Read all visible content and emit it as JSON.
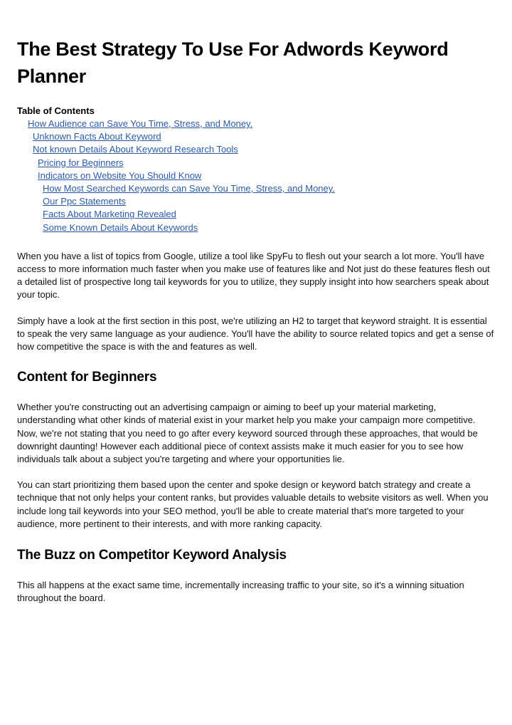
{
  "title": "The Best Strategy To Use For Adwords Keyword Planner",
  "toc": {
    "heading": "Table of Contents",
    "items": [
      {
        "label": "How Audience can Save You Time, Stress, and Money."
      },
      {
        "label": "Unknown Facts About Keyword"
      },
      {
        "label": "Not known Details About Keyword Research Tools"
      },
      {
        "label": "Pricing for Beginners"
      },
      {
        "label": "Indicators on Website You Should Know"
      },
      {
        "label": "How Most Searched Keywords can Save You Time, Stress, and Money."
      },
      {
        "label": "Our Ppc Statements"
      },
      {
        "label": "Facts About Marketing Revealed"
      },
      {
        "label": "Some Known Details About Keywords"
      }
    ]
  },
  "colors": {
    "link": "#2a5bab",
    "text": "#111111"
  },
  "body": {
    "p1": "When you have a list of topics from Google, utilize a tool like SpyFu to flesh out your search a lot more. You'll have access to more information much faster when you make use of features like and Not just do these features flesh out a detailed list of prospective long tail keywords for you to utilize, they supply insight into how searchers speak about your topic.",
    "p2": "Simply have a look at the first section in this post, we're utilizing an H2 to target that keyword straight. It is essential to speak the very same language as your audience. You'll have the ability to source related topics and get a sense of how competitive the space is with the and features as well.",
    "h2a": "Content for Beginners",
    "p3": "Whether you're constructing out an advertising campaign or aiming to beef up your material marketing, understanding what other kinds of material exist in your market help you make your campaign more competitive. Now, we're not stating that you need to go after every keyword sourced through these approaches, that would be downright daunting! However each additional piece of context assists make it much easier for you to see how individuals talk about a subject you're targeting and where your opportunities lie.",
    "p4": "You can start prioritizing them based upon the center and spoke design or keyword batch strategy and create a technique that not only helps your content ranks, but provides valuable details to website visitors as well. When you include long tail keywords into your SEO method, you'll be able to create material that's more targeted to your audience, more pertinent to their interests, and with more ranking capacity.",
    "h2b": "The Buzz on Competitor Keyword Analysis",
    "p5": "This all happens at the exact same time, incrementally increasing traffic to your site, so it's a winning situation throughout the board."
  }
}
